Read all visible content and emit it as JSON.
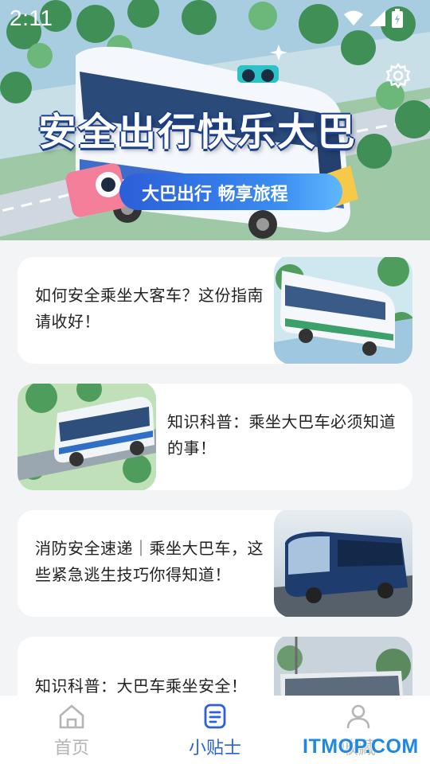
{
  "status_bar": {
    "time": "2:11"
  },
  "hero": {
    "title": "安全出行快乐大巴",
    "subtitle": "大巴出行 畅享旅程"
  },
  "tips": [
    {
      "title": "如何安全乘坐大客车？这份指南请收好！",
      "image_side": "right"
    },
    {
      "title": "知识科普：乘坐大巴车必须知道的事！",
      "image_side": "left"
    },
    {
      "title": "消防安全速递｜乘坐大巴车，这些紧急逃生技巧你得知道！",
      "image_side": "right"
    },
    {
      "title": "知识科普：大巴车乘坐安全！",
      "image_side": "right"
    }
  ],
  "nav": {
    "items": [
      {
        "label": "首页",
        "icon": "home-icon",
        "active": false
      },
      {
        "label": "小贴士",
        "icon": "tips-icon",
        "active": true
      },
      {
        "label": "收藏",
        "icon": "user-icon",
        "active": false
      }
    ],
    "active_color": "#2a5fe0",
    "inactive_color": "#b5b5b5"
  },
  "watermark": "ITMOP.COM"
}
